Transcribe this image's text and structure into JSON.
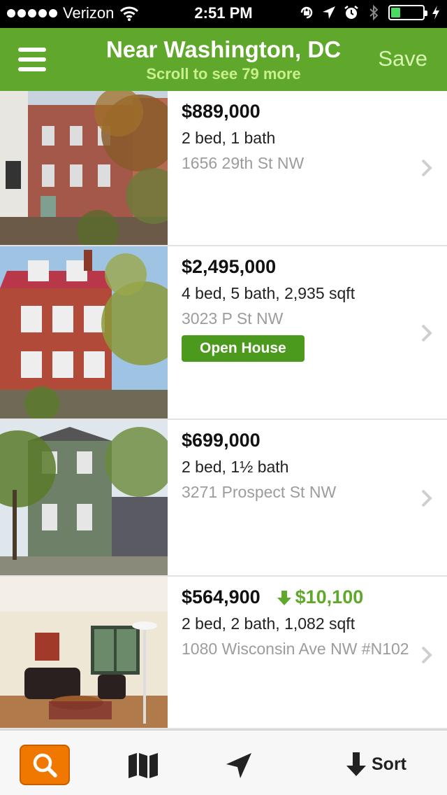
{
  "status_bar": {
    "carrier": "Verizon",
    "time": "2:51 PM",
    "battery_level": 0.35
  },
  "header": {
    "title": "Near Washington, DC",
    "subtitle": "Scroll to see 79 more",
    "save_label": "Save"
  },
  "listings": [
    {
      "price": "$889,000",
      "details": "2 bed, 1 bath",
      "address": "1656 29th St NW",
      "photo": "brick-townhouse-autumn"
    },
    {
      "price": "$2,495,000",
      "details": "4 bed, 5 bath, 2,935 sqft",
      "address": "3023 P St NW",
      "badge": "Open House",
      "photo": "red-brick-colonial"
    },
    {
      "price": "$699,000",
      "details": "2 bed, 1½ bath",
      "address": "3271 Prospect St NW",
      "photo": "green-clapboard-house"
    },
    {
      "price": "$564,900",
      "price_drop": "$10,100",
      "details": "2 bed, 2 bath, 1,082 sqft",
      "address": "1080 Wisconsin Ave NW #N102",
      "photo": "living-room-interior"
    }
  ],
  "tabbar": {
    "sort_label": "Sort",
    "icons": [
      "search-icon",
      "map-icon",
      "location-arrow-icon",
      "sort-arrow-icon"
    ]
  },
  "colors": {
    "header_green": "#5fa82b",
    "badge_green": "#4c9a1d",
    "search_orange": "#f07800"
  }
}
